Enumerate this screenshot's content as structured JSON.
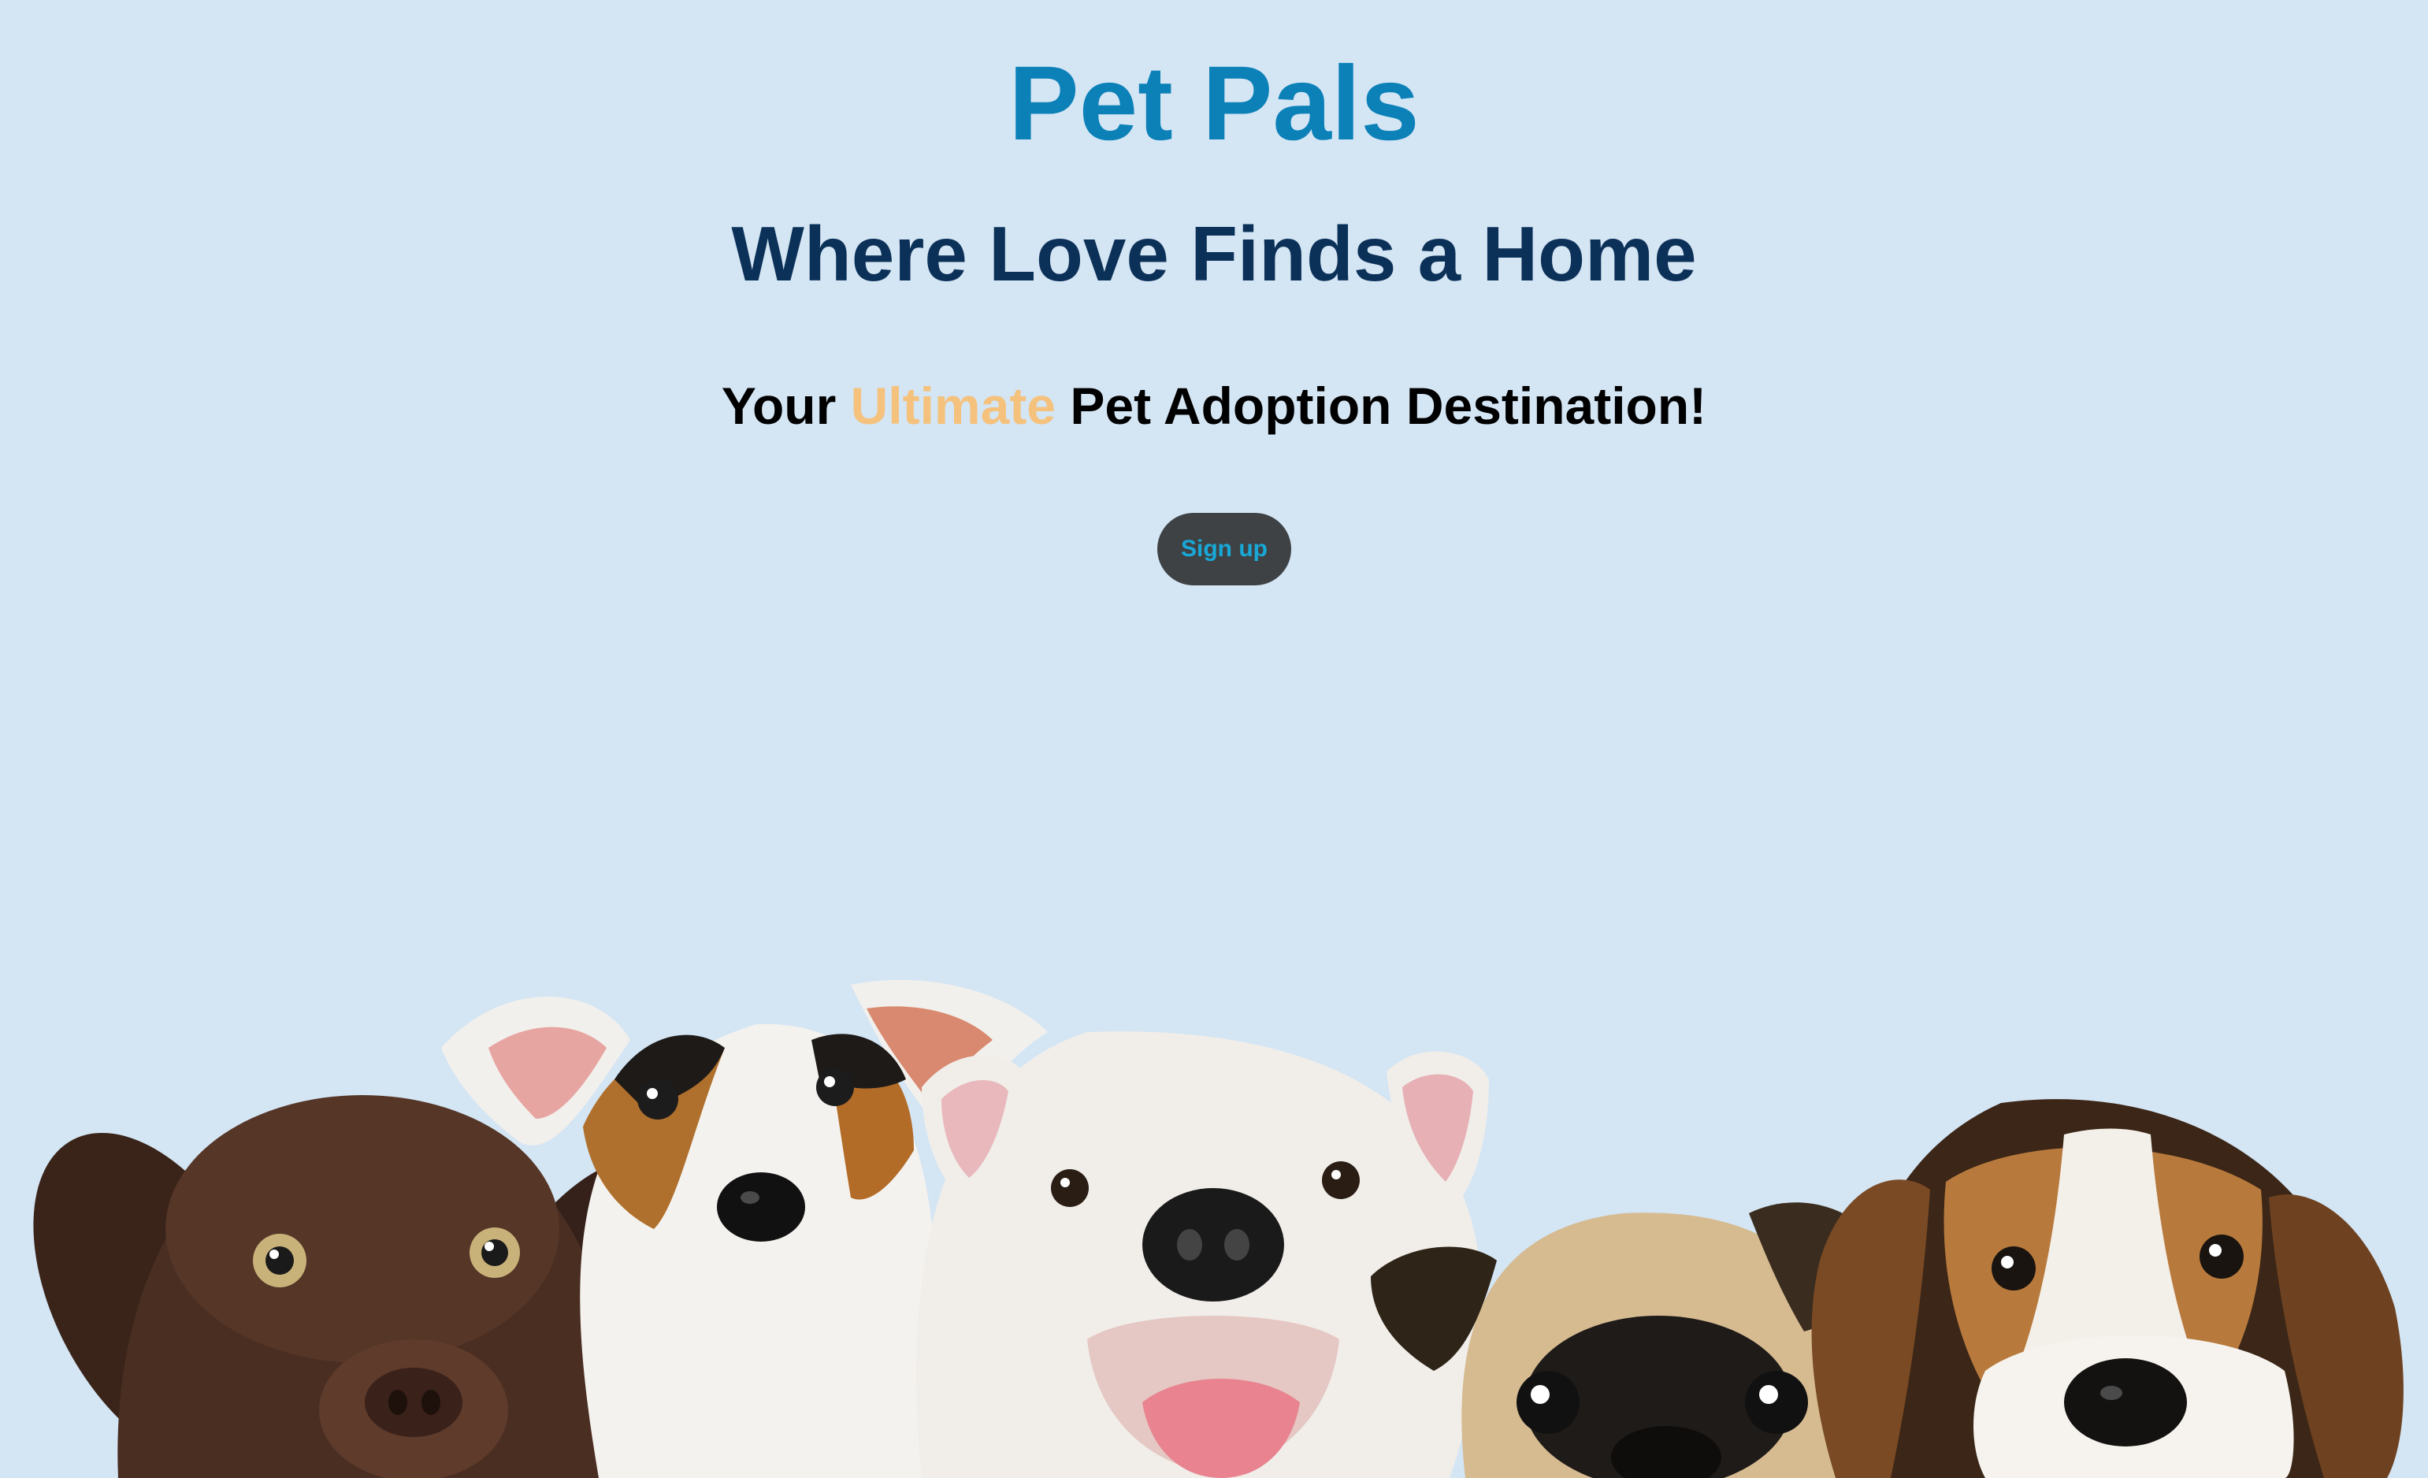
{
  "brand": {
    "title": "Pet Pals"
  },
  "hero": {
    "headline": "Where Love Finds a Home",
    "tagline_prefix": "Your ",
    "tagline_accent": "Ultimate",
    "tagline_suffix": " Pet Adoption Destination!",
    "signup_label": "Sign up"
  },
  "colors": {
    "background": "#d4e5f4",
    "brand": "#0b81b8",
    "headline": "#0c3158",
    "accent": "#f5c27e",
    "button_bg": "#3e4244",
    "button_text": "#18a8d8"
  },
  "images": {
    "hero_dogs": [
      "brown-labrador-puppy",
      "jack-russell-terrier-puppy",
      "white-bulldog-puppy",
      "pug-puppy",
      "beagle-puppy"
    ]
  }
}
